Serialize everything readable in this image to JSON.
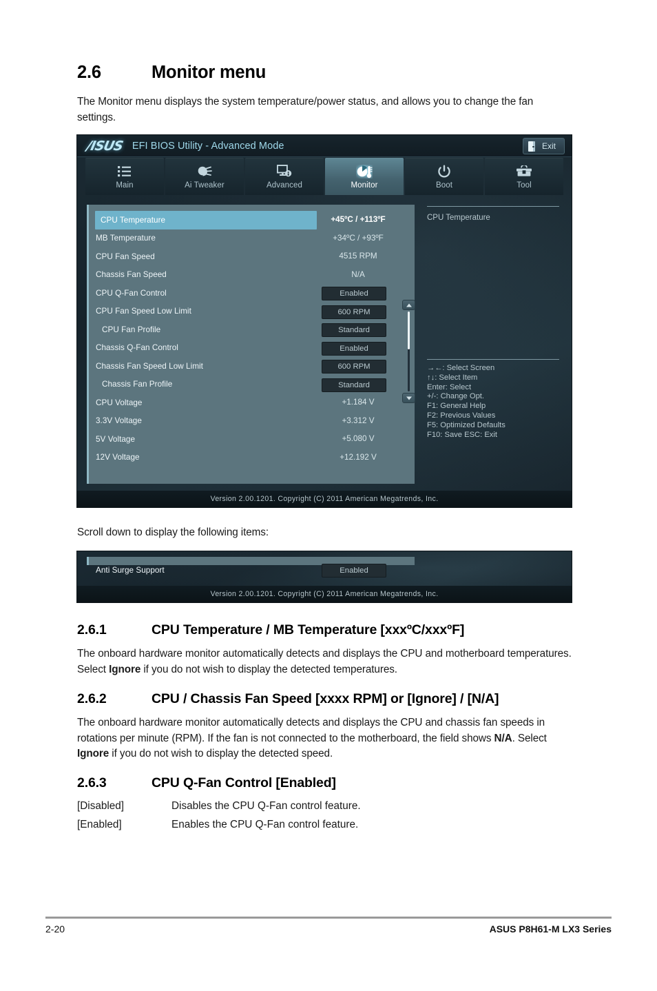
{
  "document": {
    "section_number": "2.6",
    "section_title": "Monitor menu",
    "intro": "The Monitor menu displays the system temperature/power status, and allows you to change the fan settings.",
    "scroll_note": "Scroll down to display the following items:",
    "subsections": [
      {
        "number": "2.6.1",
        "title": "CPU Temperature / MB Temperature [xxxºC/xxxºF]",
        "body_1": "The onboard hardware monitor automatically detects and displays the CPU and motherboard temperatures. Select ",
        "body_bold": "Ignore",
        "body_2": " if you do not wish to display the detected temperatures."
      },
      {
        "number": "2.6.2",
        "title": "CPU / Chassis Fan Speed [xxxx RPM] or [Ignore] / [N/A]",
        "body_1": "The onboard hardware monitor automatically detects and displays the CPU and chassis fan speeds in rotations per minute (RPM). If the fan is not connected to the motherboard, the field shows ",
        "body_bold": "N/A",
        "body_2": ". Select ",
        "body_bold_2": "Ignore",
        "body_3": " if you do not wish to display the detected speed."
      },
      {
        "number": "2.6.3",
        "title": "CPU Q-Fan Control [Enabled]",
        "options": [
          {
            "key": "[Disabled]",
            "desc": "Disables the CPU Q-Fan control feature."
          },
          {
            "key": "[Enabled]",
            "desc": "Enables the CPU Q-Fan control feature."
          }
        ]
      }
    ],
    "footer": {
      "page_number": "2-20",
      "product": "ASUS P8H61-M LX3 Series"
    }
  },
  "bios": {
    "titlebar": {
      "logo": "/ISUS",
      "title": "EFI BIOS Utility - Advanced Mode",
      "exit_label": "Exit",
      "exit_icon": "exit-door-icon"
    },
    "tabs": [
      {
        "label": "Main",
        "icon": "list-icon",
        "active": false
      },
      {
        "label": "Ai  Tweaker",
        "icon": "tweak-dial-icon",
        "active": false
      },
      {
        "label": "Advanced",
        "icon": "monitor-info-icon",
        "active": false
      },
      {
        "label": "Monitor",
        "icon": "fan-thermometer-icon",
        "active": true
      },
      {
        "label": "Boot",
        "icon": "power-icon",
        "active": false
      },
      {
        "label": "Tool",
        "icon": "toolbox-icon",
        "active": false
      }
    ],
    "items": [
      {
        "label": "CPU Temperature",
        "value": "+45ºC / +113ºF",
        "type": "readout",
        "selected": true,
        "indent": false
      },
      {
        "label": "MB Temperature",
        "value": "+34ºC / +93ºF",
        "type": "readout",
        "selected": false,
        "indent": false
      },
      {
        "label": "CPU Fan Speed",
        "value": "4515 RPM",
        "type": "readout",
        "selected": false,
        "indent": false
      },
      {
        "label": "Chassis Fan Speed",
        "value": "N/A",
        "type": "readout",
        "selected": false,
        "indent": false
      },
      {
        "label": "CPU Q-Fan Control",
        "value": "Enabled",
        "type": "option",
        "selected": false,
        "indent": false
      },
      {
        "label": "CPU Fan Speed Low Limit",
        "value": "600 RPM",
        "type": "option",
        "selected": false,
        "indent": false
      },
      {
        "label": "CPU Fan Profile",
        "value": "Standard",
        "type": "option",
        "selected": false,
        "indent": true
      },
      {
        "label": "Chassis Q-Fan Control",
        "value": "Enabled",
        "type": "option",
        "selected": false,
        "indent": false
      },
      {
        "label": "Chassis Fan Speed Low Limit",
        "value": "600 RPM",
        "type": "option",
        "selected": false,
        "indent": false
      },
      {
        "label": "Chassis Fan Profile",
        "value": "Standard",
        "type": "option",
        "selected": false,
        "indent": true
      },
      {
        "label": "CPU Voltage",
        "value": "+1.184 V",
        "type": "readout",
        "selected": false,
        "indent": false
      },
      {
        "label": "3.3V Voltage",
        "value": "+3.312 V",
        "type": "readout",
        "selected": false,
        "indent": false
      },
      {
        "label": "5V Voltage",
        "value": "+5.080 V",
        "type": "readout",
        "selected": false,
        "indent": false
      },
      {
        "label": "12V Voltage",
        "value": "+12.192 V",
        "type": "readout",
        "selected": false,
        "indent": false
      }
    ],
    "help": {
      "description": "CPU Temperature",
      "keys": [
        "→←:  Select Screen",
        "↑↓:  Select Item",
        "Enter:  Select",
        "+/-:  Change Opt.",
        "F1:  General Help",
        "F2:  Previous Values",
        "F5:  Optimized Defaults",
        "F10:  Save    ESC:  Exit"
      ]
    },
    "version": "Version  2.00.1201.   Copyright  (C)  2011  American  Megatrends,  Inc.",
    "scroll_panel": {
      "items": [
        {
          "label": "Anti Surge Support",
          "value": "Enabled",
          "type": "option",
          "selected": false,
          "indent": false
        }
      ],
      "version": "Version  2.00.1201.   Copyright  (C)  2011  American  Megatrends,  Inc."
    }
  },
  "colors": {
    "highlight": "#6fb3cb",
    "panel_bg": "#5c757e",
    "accent_cyan": "#8fe3f8",
    "pill_bg": "#222d33"
  }
}
